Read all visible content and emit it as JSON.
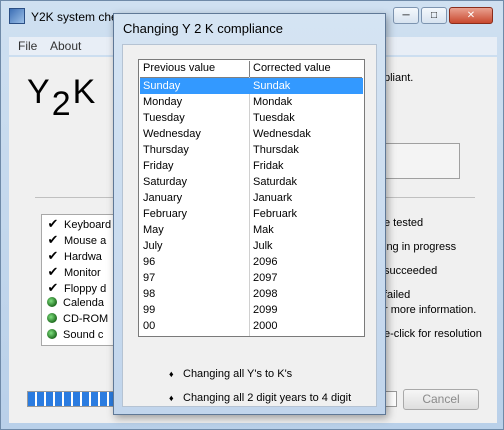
{
  "main": {
    "title": "Y2K system che",
    "menu": [
      "File",
      "About"
    ],
    "logo": "Y2K",
    "status": "pliant.",
    "items": [
      {
        "label": "Keyboard",
        "icon": "check-icon"
      },
      {
        "label": "Mouse a",
        "icon": "check-icon"
      },
      {
        "label": "Hardwa",
        "icon": "check-icon"
      },
      {
        "label": "Monitor",
        "icon": "check-icon"
      },
      {
        "label": "Floppy d",
        "icon": "check-icon"
      },
      {
        "label": "Calenda",
        "icon": "green-dot-icon"
      },
      {
        "label": "CD-ROM",
        "icon": "green-dot-icon"
      },
      {
        "label": "Sound c",
        "icon": "green-dot-icon"
      }
    ],
    "legend": {
      "tested": "e tested",
      "progress": "ing in progress",
      "succeeded": "succeeded",
      "failed": "failed",
      "info": "r more information.",
      "resolution": "e-click for resolution"
    },
    "progress_fraction": 0.32,
    "cancel_label": "Cancel"
  },
  "dialog": {
    "title": "Changing Y 2 K compliance",
    "columns": [
      "Previous value",
      "Corrected value"
    ],
    "rows": [
      [
        "Sunday",
        "Sundak"
      ],
      [
        "Monday",
        "Mondak"
      ],
      [
        "Tuesday",
        "Tuesdak"
      ],
      [
        "Wednesday",
        "Wednesdak"
      ],
      [
        "Thursday",
        "Thursdak"
      ],
      [
        "Friday",
        "Fridak"
      ],
      [
        "Saturday",
        "Saturdak"
      ],
      [
        "January",
        "Januark"
      ],
      [
        "February",
        "Februark"
      ],
      [
        "May",
        "Mak"
      ],
      [
        "July",
        "Julk"
      ],
      [
        "96",
        "2096"
      ],
      [
        "97",
        "2097"
      ],
      [
        "98",
        "2098"
      ],
      [
        "99",
        "2099"
      ],
      [
        "00",
        "2000"
      ]
    ],
    "selected_row": 0,
    "bullets": [
      "Changing all Y's to K's",
      "Changing all 2 digit years to 4 digit"
    ]
  },
  "colors": {
    "selection": "#3399ff",
    "progress": "#2b7ce0"
  }
}
